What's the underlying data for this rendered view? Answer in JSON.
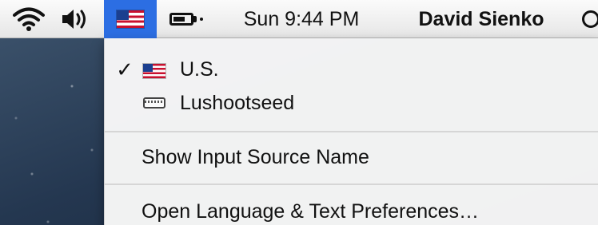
{
  "menubar": {
    "clock": "Sun 9:44 PM",
    "user": "David Sienko",
    "battery_level": 0.7
  },
  "icons": {
    "wifi": "wifi-icon",
    "volume": "volume-icon",
    "input_flag": "us-flag-icon",
    "battery": "battery-icon",
    "spotlight": "spotlight-icon",
    "keyboard": "keyboard-icon",
    "checkmark": "checkmark-icon"
  },
  "colors": {
    "highlight": "#2c6ee3",
    "flag_red": "#c8102e",
    "flag_blue": "#1b3f8f"
  },
  "input_menu": {
    "sources": [
      {
        "label": "U.S.",
        "selected": true,
        "check": "✓"
      },
      {
        "label": "Lushootseed",
        "selected": false
      }
    ],
    "show_name_label": "Show Input Source Name",
    "open_prefs_label": "Open Language & Text Preferences…"
  }
}
